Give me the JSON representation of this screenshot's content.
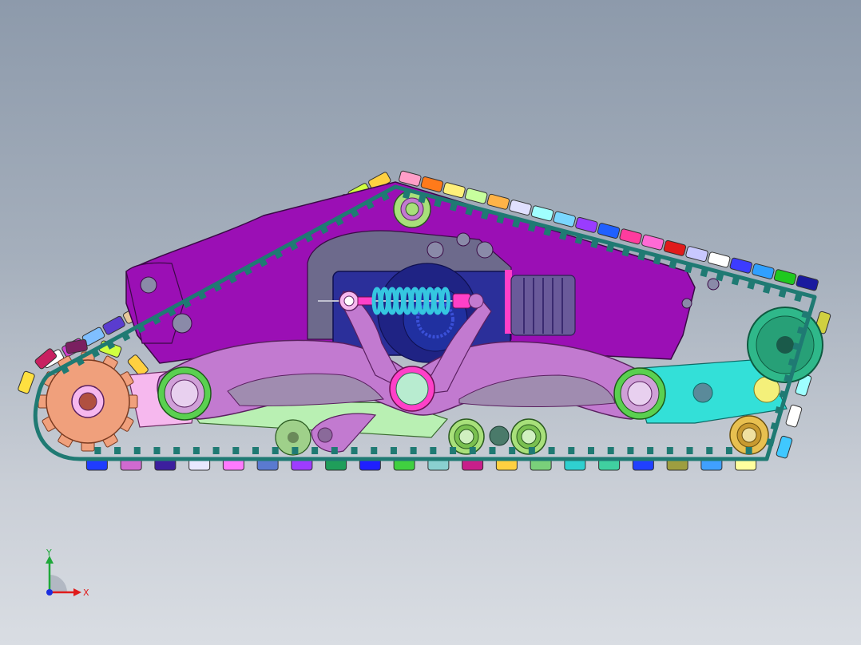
{
  "app": {
    "view": "front"
  },
  "colors": {
    "background_top": "#8d9aab",
    "background_bottom": "#d9dde3",
    "side_plate": "#9b0fb5",
    "track_belt": "#1f7a73",
    "track_tooth": "#1f7a73",
    "swing_arm": "#c27ad0",
    "sprocket": "#f0a07c",
    "idler_wheel": "#2fb88a",
    "spring": "#35c6e0",
    "motor_block": "#2b2f9a",
    "cyan_link": "#33e0d8",
    "axis_x": "#e01b1b",
    "axis_y": "#1fa83a",
    "axis_z": "#1b2ee0"
  },
  "triad": {
    "x_label": "X",
    "y_label": "Y"
  },
  "grousers": {
    "top_colors": [
      "#ff9ec8",
      "#ff7a1a",
      "#fff07a",
      "#c8ff9e",
      "#ffb347",
      "#e0e0ff",
      "#a0ffff",
      "#7ad7ff",
      "#9a3cff",
      "#2060ff",
      "#ff3c9e",
      "#ff6ad5",
      "#e01b1b",
      "#c8c8ff",
      "#ffffff",
      "#3c3cff",
      "#30a0ff",
      "#1fc81f",
      "#1a1a9e"
    ],
    "left_colors": [
      "#ffffff",
      "#d040d0",
      "#7fbfff",
      "#5a3ccf",
      "#e7c79a",
      "#2fd0ff",
      "#c8ff3c",
      "#1fc81f",
      "#ff2f2f",
      "#c8ff9e",
      "#30c830",
      "#9e9e9e",
      "#1f1f8a",
      "#e0e020",
      "#c82020",
      "#d0ff40",
      "#ffd040"
    ],
    "bottom_colors": [
      "#1f3cff",
      "#d06ad0",
      "#3c1f9e",
      "#e8e8ff",
      "#ff7aff",
      "#5a7ad0",
      "#9e3cff",
      "#1f9e5a",
      "#1f1fff",
      "#40d040",
      "#8ad0d0",
      "#c81f8a",
      "#ffd040",
      "#7ad07a",
      "#2fd0d0",
      "#40d0a0",
      "#2040ff",
      "#9e9e40",
      "#40a0ff",
      "#ffff9e"
    ],
    "right_colors": [
      "#d0d040",
      "#c83c9e",
      "#9effff",
      "#ffffff",
      "#40c8ff"
    ]
  }
}
